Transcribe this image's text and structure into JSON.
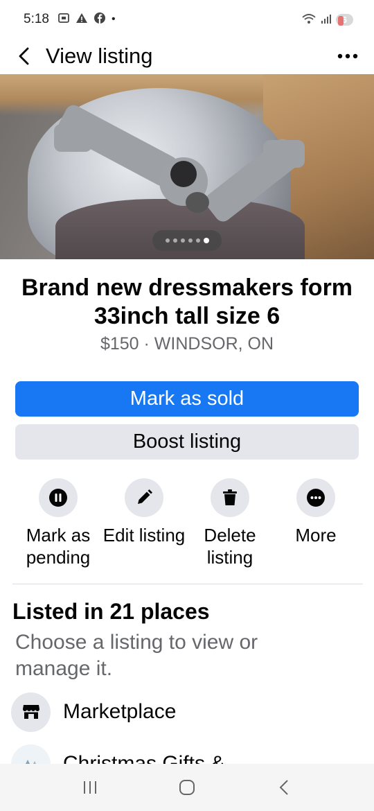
{
  "status": {
    "time": "5:18",
    "battery": "6"
  },
  "header": {
    "title": "View listing"
  },
  "gallery": {
    "image_count": 6,
    "current_index": 6
  },
  "listing": {
    "title": "Brand new dressmakers form 33inch tall size 6",
    "meta": "$150 · WINDSOR, ON"
  },
  "buttons": {
    "mark_sold": "Mark as sold",
    "boost": "Boost listing"
  },
  "actions": [
    {
      "label": "Mark as pending",
      "icon": "pause-icon"
    },
    {
      "label": "Edit listing",
      "icon": "pencil-icon"
    },
    {
      "label": "Delete listing",
      "icon": "trash-icon"
    },
    {
      "label": "More",
      "icon": "more-icon"
    }
  ],
  "places": {
    "title": "Listed in 21 places",
    "subtitle": "Choose a listing to view or manage it.",
    "items": [
      {
        "name": "Marketplace",
        "icon": "storefront-icon"
      },
      {
        "name": "Christmas Gifts &",
        "icon": "group-avatar"
      }
    ]
  },
  "colors": {
    "primary": "#1877f2",
    "secondary_bg": "#e4e6eb",
    "muted_text": "#65676b"
  }
}
